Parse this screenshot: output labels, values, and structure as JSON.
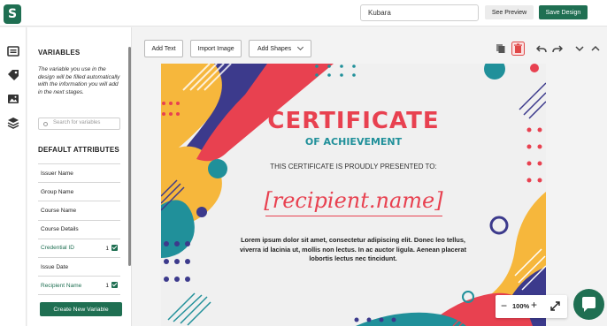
{
  "app": {
    "logo_letter": "S"
  },
  "header": {
    "design_name": "Kubara",
    "preview_label": "See Preview",
    "save_label": "Save Design"
  },
  "sidebar": {
    "title": "VARIABLES",
    "description": "The variable you use in the design will be filled automatically with the information you will add in the next stages.",
    "search_placeholder": "Search for variables",
    "default_title": "DEFAULT ATTRIBUTES",
    "attributes": [
      {
        "label": "Issuer Name"
      },
      {
        "label": "Group Name"
      },
      {
        "label": "Course Name"
      },
      {
        "label": "Course Details"
      },
      {
        "label": "Credential ID",
        "count": "1",
        "checked": true
      },
      {
        "label": "Issue Date"
      },
      {
        "label": "Recipient Name",
        "count": "1",
        "checked": true
      }
    ],
    "create_label": "Create New Variable"
  },
  "toolbar": {
    "add_text": "Add Text",
    "import_image": "Import Image",
    "add_shapes": "Add Shapes"
  },
  "certificate": {
    "title": "CERTIFICATE",
    "subtitle": "OF ACHIEVEMENT",
    "presented": "THIS CERTIFICATE IS PROUDLY PRESENTED TO:",
    "recipient": "[recipient.name]",
    "body": "Lorem ipsum dolor sit amet, consectetur adipiscing elit. Donec leo tellus, viverra id lacinia ut, mollis non lectus. In ac auctor ligula. Aenean placerat lobortis lectus nec tincidunt."
  },
  "zoom": {
    "minus": "−",
    "value": "100%",
    "plus": "+"
  },
  "colors": {
    "brand": "#1f6f52",
    "cert_red": "#e84150",
    "cert_teal": "#20909a",
    "cert_navy": "#3c3a8c",
    "cert_yellow": "#f6b73c"
  }
}
